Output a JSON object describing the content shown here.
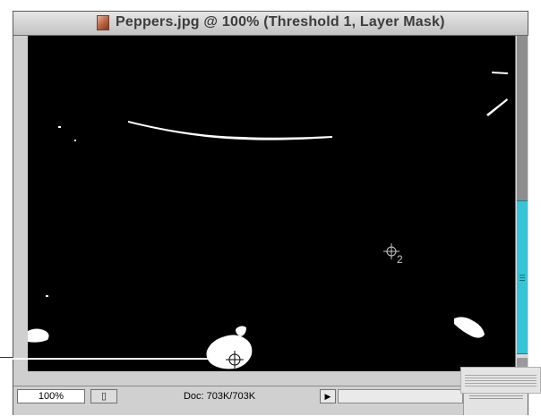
{
  "window": {
    "title": "Peppers.jpg @ 100% (Threshold 1, Layer Mask)",
    "icon": "document-thumbnail-icon"
  },
  "canvas": {
    "background": "#000000",
    "samplers": [
      {
        "label": "2",
        "icon": "color-sampler-icon"
      },
      {
        "label": "",
        "icon": "color-sampler-icon"
      }
    ]
  },
  "scrollbar": {
    "thumb_color": "#36c4d8"
  },
  "statusbar": {
    "zoom": "100%",
    "doc_info": "Doc: 703K/703K",
    "doc_button_icon": "document-icon",
    "popup_icon": "triangle-right-icon"
  }
}
